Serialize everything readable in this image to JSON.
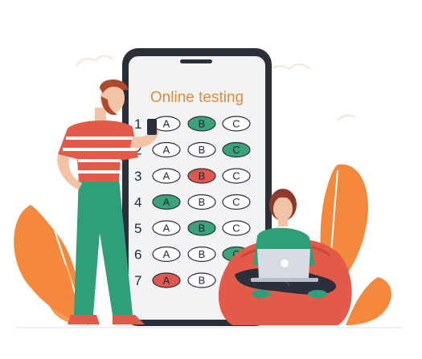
{
  "screen": {
    "title": "Online testing"
  },
  "colors": {
    "selected_green": "#3aa37a",
    "selected_red": "#e0574f",
    "phone_frame": "#2b2f3a",
    "screen_bg": "#f2f3f5",
    "leaf": "#f4883c",
    "accent_title": "#e08a3c"
  },
  "questions": [
    {
      "number": "1",
      "options": [
        "A",
        "B",
        "C"
      ],
      "selected": "B",
      "state": "green"
    },
    {
      "number": "2",
      "options": [
        "A",
        "B",
        "C"
      ],
      "selected": "C",
      "state": "green"
    },
    {
      "number": "3",
      "options": [
        "A",
        "B",
        "C"
      ],
      "selected": "B",
      "state": "red"
    },
    {
      "number": "4",
      "options": [
        "A",
        "B",
        "C"
      ],
      "selected": "A",
      "state": "green"
    },
    {
      "number": "5",
      "options": [
        "A",
        "B",
        "C"
      ],
      "selected": "B",
      "state": "green"
    },
    {
      "number": "6",
      "options": [
        "A",
        "B",
        "C"
      ],
      "selected": "C",
      "state": "green"
    },
    {
      "number": "7",
      "options": [
        "A",
        "B"
      ],
      "selected": "A",
      "state": "red"
    }
  ],
  "icons": {
    "phone": "smartphone-icon",
    "laptop": "laptop-icon",
    "leaf": "leaf-icon"
  }
}
